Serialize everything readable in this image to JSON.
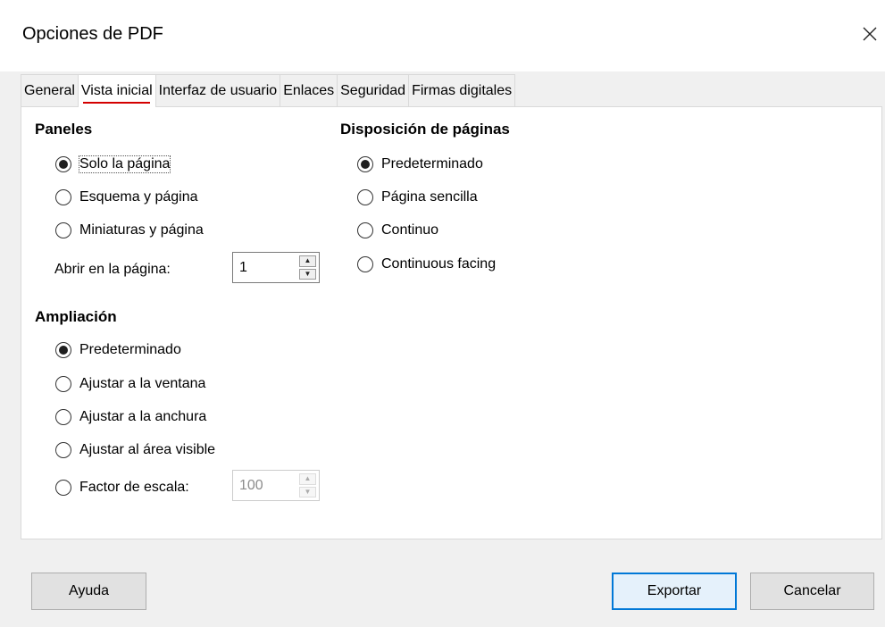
{
  "window": {
    "title": "Opciones de PDF"
  },
  "tabs": [
    {
      "label": "General"
    },
    {
      "label": "Vista inicial"
    },
    {
      "label": "Interfaz de usuario"
    },
    {
      "label": "Enlaces"
    },
    {
      "label": "Seguridad"
    },
    {
      "label": "Firmas digitales"
    }
  ],
  "panels": {
    "heading": "Paneles",
    "options": [
      {
        "label": "Solo la página",
        "checked": true
      },
      {
        "label": "Esquema y página",
        "checked": false
      },
      {
        "label": "Miniaturas y página",
        "checked": false
      }
    ],
    "open_page_label": "Abrir en la página:",
    "open_page_value": "1"
  },
  "magnification": {
    "heading": "Ampliación",
    "options": [
      {
        "label": "Predeterminado",
        "checked": true
      },
      {
        "label": "Ajustar a la ventana",
        "checked": false
      },
      {
        "label": "Ajustar a la anchura",
        "checked": false
      },
      {
        "label": "Ajustar al área visible",
        "checked": false
      },
      {
        "label": "Factor de escala:",
        "checked": false
      }
    ],
    "zoom_value": "100"
  },
  "page_layout": {
    "heading": "Disposición de páginas",
    "options": [
      {
        "label": "Predeterminado",
        "checked": true
      },
      {
        "label": "Página sencilla",
        "checked": false
      },
      {
        "label": "Continuo",
        "checked": false
      },
      {
        "label": "Continuous facing",
        "checked": false
      }
    ]
  },
  "buttons": {
    "help": "Ayuda",
    "export": "Exportar",
    "cancel": "Cancelar"
  },
  "colors": {
    "active_tab_underline": "#d40000",
    "focus_blue": "#0078d7"
  }
}
